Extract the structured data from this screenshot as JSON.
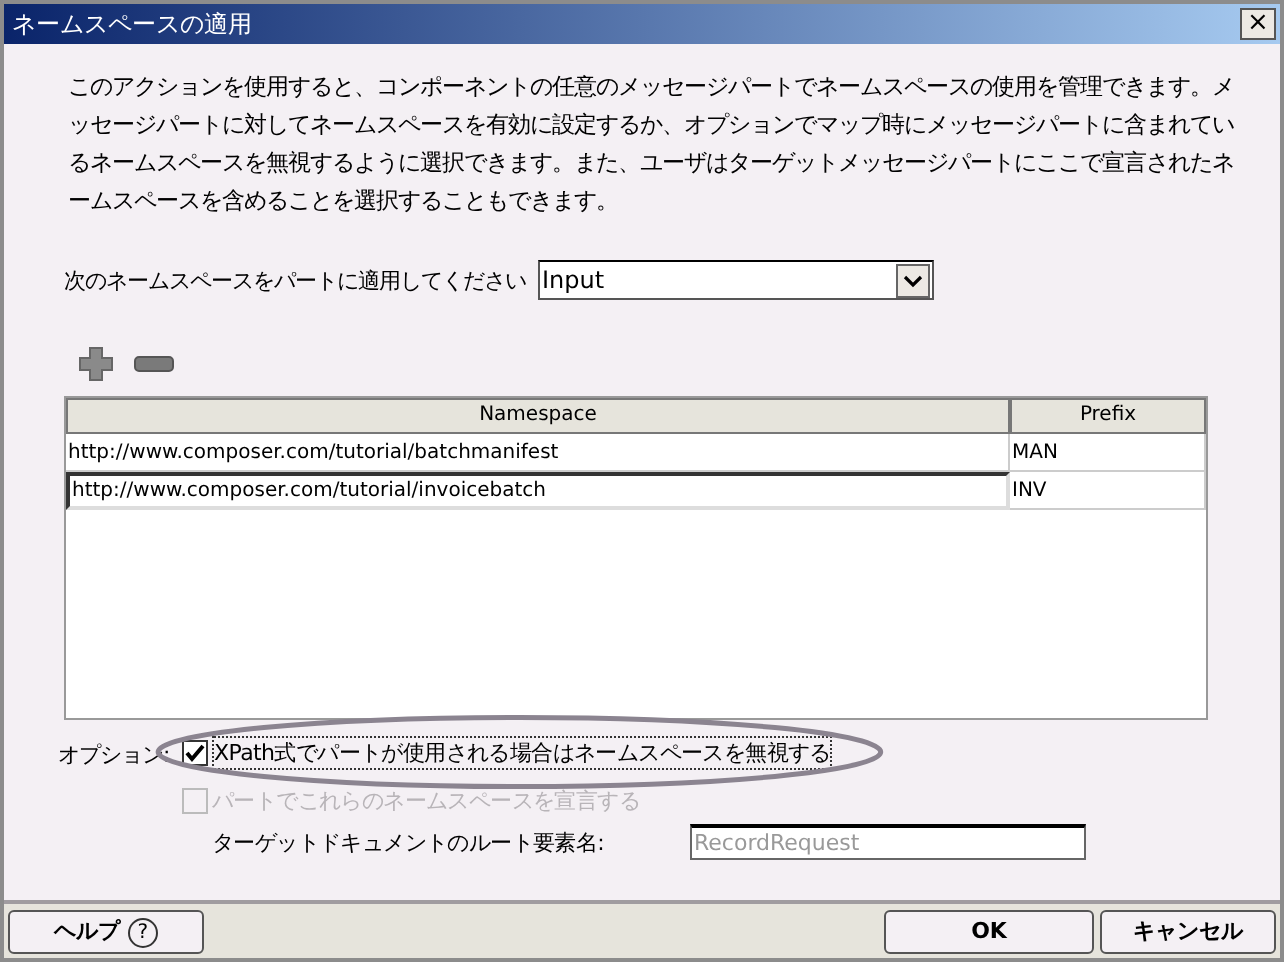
{
  "window": {
    "title": "ネームスペースの適用",
    "close": "×"
  },
  "description": "このアクションを使用すると、コンポーネントの任意のメッセージパートでネームスペースの使用を管理できます。メッセージパートに対してネームスペースを有効に設定するか、オプションでマップ時にメッセージパートに含まれているネームスペースを無視するように選択できます。また、ユーザはターゲットメッセージパートにここで宣言されたネームスペースを含めることを選択することもできます。",
  "part_select": {
    "label": "次のネームスペースをパートに適用してください",
    "value": "Input"
  },
  "table": {
    "columns": [
      "Namespace",
      "Prefix"
    ],
    "rows": [
      {
        "namespace": "http://www.composer.com/tutorial/batchmanifest",
        "prefix": "MAN",
        "editing": false
      },
      {
        "namespace": "http://www.composer.com/tutorial/invoicebatch",
        "prefix": "INV",
        "editing": true
      }
    ]
  },
  "options": {
    "label": "オプション:",
    "checkboxes": [
      {
        "label": "XPath式でパートが使用される場合はネームスペースを無視する",
        "checked": true,
        "disabled": false,
        "highlighted": true
      },
      {
        "label": "パートでこれらのネームスペースを宣言する",
        "checked": false,
        "disabled": true,
        "highlighted": false
      }
    ]
  },
  "root_element": {
    "label": "ターゲットドキュメントのルート要素名:",
    "placeholder": "RecordRequest"
  },
  "buttons": {
    "help": "ヘルプ",
    "help_icon": "?",
    "ok": "OK",
    "cancel": "キャンセル"
  }
}
